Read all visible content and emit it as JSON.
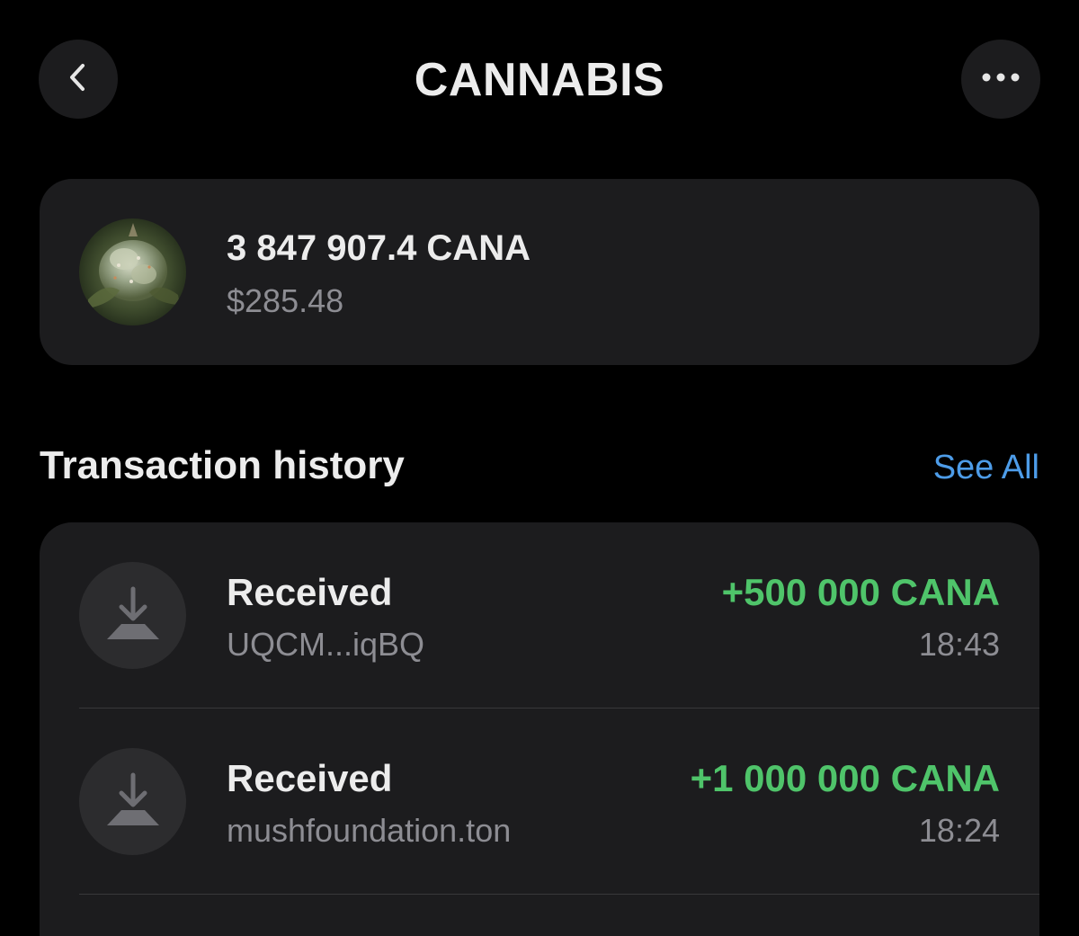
{
  "header": {
    "title": "CANNABIS",
    "back_icon": "chevron-left-icon",
    "more_icon": "more-horizontal-icon"
  },
  "balance": {
    "token_amount": "3 847 907.4 CANA",
    "fiat_amount": "$285.48",
    "avatar": "cannabis-bud-image"
  },
  "history": {
    "title": "Transaction history",
    "see_all_label": "See All",
    "items": [
      {
        "type": "Received",
        "counterparty": "UQCM...iqBQ",
        "amount": "+500 000 CANA",
        "time": "18:43",
        "icon": "download-arrow-icon"
      },
      {
        "type": "Received",
        "counterparty": "mushfoundation.ton",
        "amount": "+1 000 000 CANA",
        "time": "18:24",
        "icon": "download-arrow-icon"
      }
    ]
  },
  "colors": {
    "background": "#000000",
    "card": "#1c1c1e",
    "positive": "#4fc46a",
    "link": "#4d9ce8",
    "secondary_text": "#8d8d93"
  }
}
